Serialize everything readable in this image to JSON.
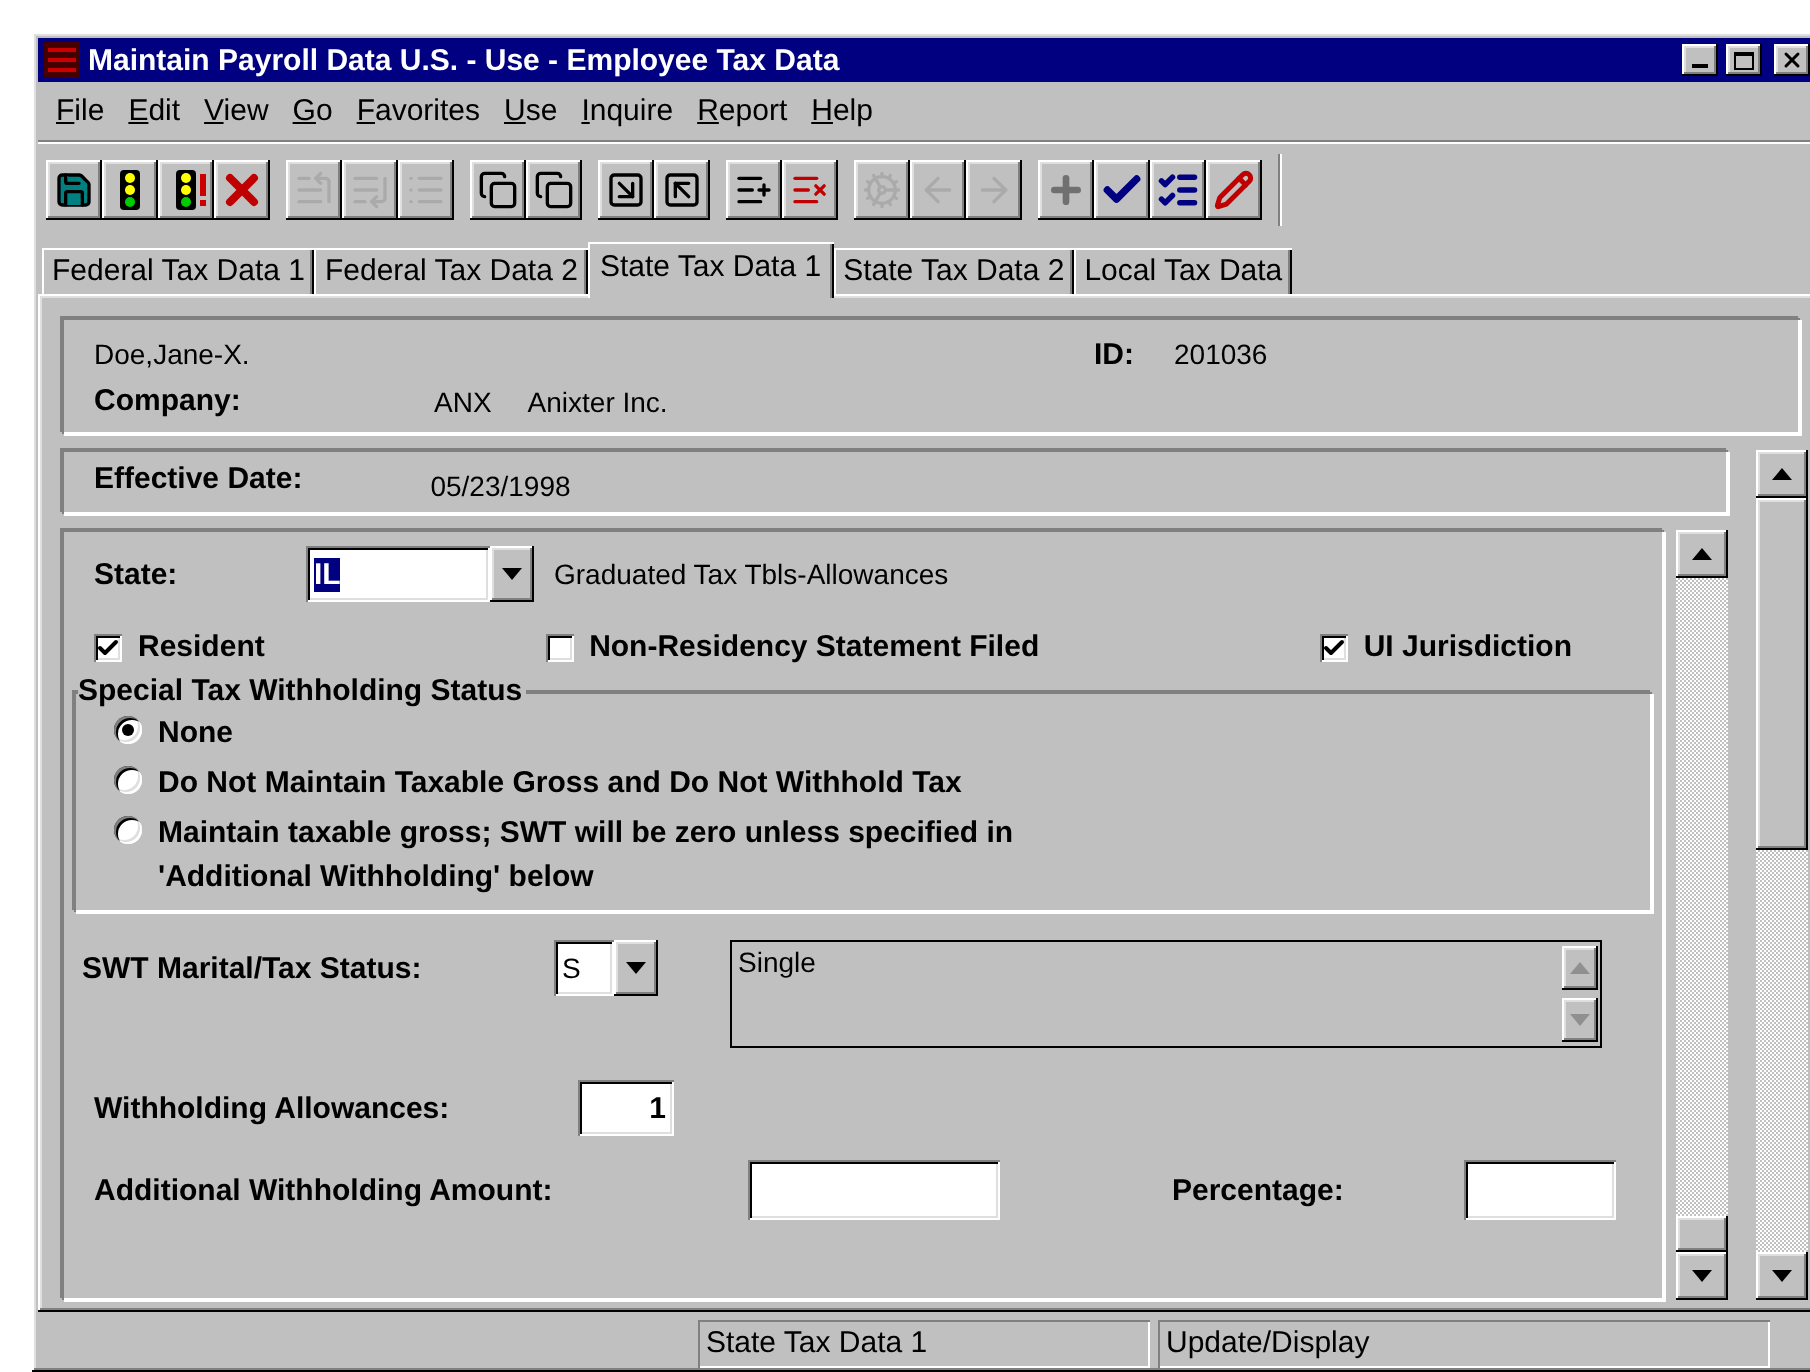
{
  "window": {
    "title": "Maintain Payroll Data U.S. - Use - Employee Tax Data"
  },
  "menu": [
    {
      "label": "File"
    },
    {
      "label": "Edit"
    },
    {
      "label": "View"
    },
    {
      "label": "Go"
    },
    {
      "label": "Favorites"
    },
    {
      "label": "Use"
    },
    {
      "label": "Inquire"
    },
    {
      "label": "Report"
    },
    {
      "label": "Help"
    }
  ],
  "toolbar": [
    [
      {
        "kind": "save",
        "disabled": false
      },
      {
        "kind": "traffic",
        "disabled": false
      },
      {
        "kind": "traffic-alert",
        "disabled": false
      },
      {
        "kind": "cancel",
        "disabled": false
      }
    ],
    [
      {
        "kind": "insert-before",
        "disabled": true
      },
      {
        "kind": "insert-after",
        "disabled": true
      },
      {
        "kind": "list",
        "disabled": true
      }
    ],
    [
      {
        "kind": "copy-down",
        "disabled": false
      },
      {
        "kind": "copy-up",
        "disabled": false
      }
    ],
    [
      {
        "kind": "arrow-down-right",
        "disabled": false
      },
      {
        "kind": "arrow-up-left",
        "disabled": false
      }
    ],
    [
      {
        "kind": "list-insert",
        "disabled": false
      },
      {
        "kind": "list-delete",
        "disabled": false
      }
    ],
    [
      {
        "kind": "gear",
        "disabled": true
      },
      {
        "kind": "arrow-left",
        "disabled": true
      },
      {
        "kind": "arrow-right",
        "disabled": true
      }
    ],
    [
      {
        "kind": "plus",
        "disabled": false
      },
      {
        "kind": "check",
        "disabled": false
      },
      {
        "kind": "check-plus",
        "disabled": false
      },
      {
        "kind": "pencil",
        "disabled": false
      }
    ]
  ],
  "tabs": [
    {
      "label": "Federal Tax Data 1",
      "selected": false
    },
    {
      "label": "Federal Tax Data 2",
      "selected": false
    },
    {
      "label": "State Tax Data 1",
      "selected": true
    },
    {
      "label": "State Tax Data 2",
      "selected": false
    },
    {
      "label": "Local Tax Data",
      "selected": false
    }
  ],
  "employee": {
    "name": "Doe,Jane-X.",
    "id_label": "ID:",
    "id": "201036",
    "company_label": "Company:",
    "company_code": "ANX",
    "company_name": "Anixter Inc."
  },
  "effective": {
    "label": "Effective Date:",
    "value": "05/23/1998"
  },
  "state": {
    "label": "State:",
    "value": "IL",
    "description": "Graduated Tax Tbls-Allowances"
  },
  "checkboxes": [
    {
      "label": "Resident",
      "checked": true
    },
    {
      "label": "Non-Residency Statement Filed",
      "checked": false
    },
    {
      "label": "UI Jurisdiction",
      "checked": true
    }
  ],
  "withholding": {
    "title": "Special Tax Withholding Status",
    "options": [
      {
        "label": "None",
        "selected": true
      },
      {
        "label": "Do Not Maintain Taxable Gross and Do Not Withhold Tax",
        "selected": false
      },
      {
        "label": "Maintain taxable gross; SWT will be zero unless specified in 'Additional Withholding' below",
        "selected": false
      }
    ]
  },
  "marital": {
    "label": "SWT Marital/Tax Status:",
    "code": "S",
    "description": "Single"
  },
  "allowances": {
    "label": "Withholding Allowances:",
    "value": "1"
  },
  "additional": {
    "label": "Additional Withholding Amount:",
    "percentage_label": "Percentage:"
  },
  "status_bar": [
    "State Tax Data 1",
    "Update/Display"
  ]
}
